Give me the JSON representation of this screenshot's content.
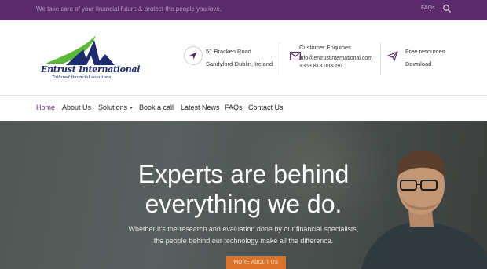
{
  "topbar": {
    "tagline": "We take care of your financial future & protect the people you love.",
    "faqs_label": "FAQs",
    "search_icon": "search-icon"
  },
  "logo": {
    "name": "Entrust International",
    "tagline": "Tailored financial solutions",
    "colors": {
      "green": "#5cb83a",
      "navy": "#1c2a6e"
    }
  },
  "contact": {
    "address_line1": "51 Bracken Road",
    "address_line2": "Sandyford-Dublin, Ireland",
    "enquiries_title": "Customer Enquiries",
    "email": "info@entrustinternational.com",
    "phone": "+353 818 003390",
    "resources_title": "Free resources",
    "resources_link": "Download",
    "icons": [
      "location-arrow-icon",
      "envelope-icon",
      "send-icon"
    ]
  },
  "nav": {
    "items": [
      {
        "label": "Home",
        "active": true
      },
      {
        "label": "About Us"
      },
      {
        "label": "Solutions",
        "dropdown": true
      },
      {
        "label": "Book a call"
      },
      {
        "label": "Latest News"
      },
      {
        "label": "FAQs"
      },
      {
        "label": "Contact Us"
      }
    ]
  },
  "hero": {
    "heading_line1": "Experts are behind",
    "heading_line2": "everything we do.",
    "sub_line1": "Whether it's the research and evaluation done by our financial specialists,",
    "sub_line2": "the people behind our technology make all the difference.",
    "cta_label": "MORE ABOUT US"
  },
  "colors": {
    "brand_purple": "#5a2a6b",
    "nav_active": "#6b2c82",
    "cta_orange": "#d9742a"
  }
}
